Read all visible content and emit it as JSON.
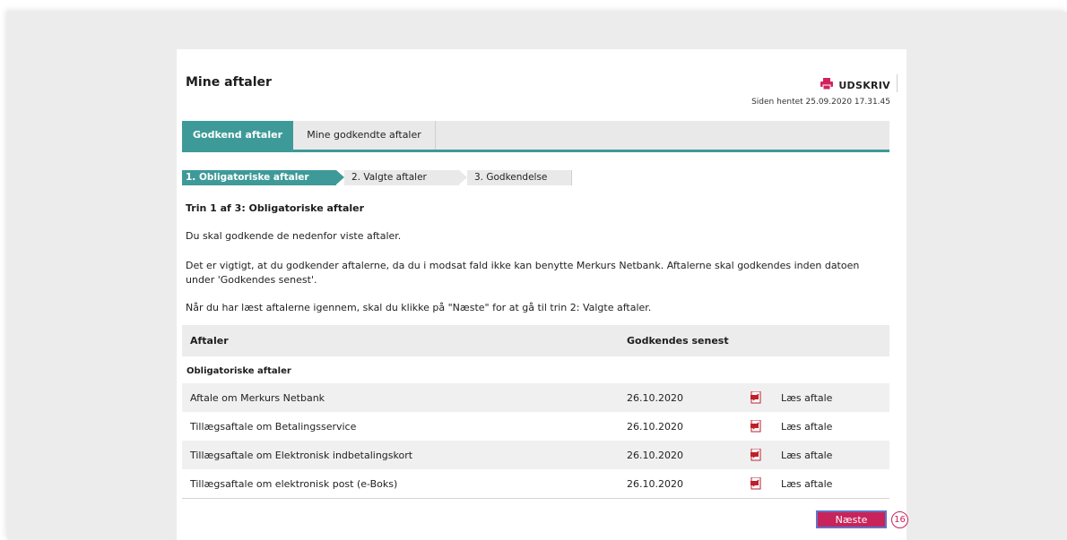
{
  "header": {
    "title": "Mine aftaler",
    "print_label": "UDSKRIV",
    "fetched_text": "Siden hentet 25.09.2020 17.31.45"
  },
  "tabs": [
    {
      "label": "Godkend aftaler",
      "active": true
    },
    {
      "label": "Mine godkendte aftaler",
      "active": false
    }
  ],
  "steps": [
    {
      "label": "1. Obligatoriske aftaler",
      "active": true
    },
    {
      "label": "2. Valgte aftaler",
      "active": false
    },
    {
      "label": "3. Godkendelse",
      "active": false
    }
  ],
  "content": {
    "step_title": "Trin 1 af 3: Obligatoriske aftaler",
    "paragraph1": "Du skal godkende de nedenfor viste aftaler.",
    "paragraph2": "Det er vigtigt, at du godkender aftalerne, da du i modsat fald ikke kan benytte Merkurs Netbank. Aftalerne skal godkendes inden datoen under 'Godkendes senest'.",
    "paragraph3": "Når du har læst aftalerne igennem, skal du klikke på \"Næste\" for at gå til trin 2: Valgte aftaler."
  },
  "table": {
    "headers": {
      "name": "Aftaler",
      "date": "Godkendes senest"
    },
    "group_title": "Obligatoriske aftaler",
    "rows": [
      {
        "name": "Aftale om Merkurs Netbank",
        "date": "26.10.2020",
        "icon": "pdf-icon",
        "link": "Læs aftale"
      },
      {
        "name": "Tillægsaftale om Betalingsservice",
        "date": "26.10.2020",
        "icon": "pdf-icon",
        "link": "Læs aftale"
      },
      {
        "name": "Tillægsaftale om Elektronisk indbetalingskort",
        "date": "26.10.2020",
        "icon": "pdf-icon",
        "link": "Læs aftale"
      },
      {
        "name": "Tillægsaftale om elektronisk post (e-Boks)",
        "date": "26.10.2020",
        "icon": "pdf-icon",
        "link": "Læs aftale"
      }
    ]
  },
  "actions": {
    "next_label": "Næste",
    "marker_number": "16"
  },
  "colors": {
    "accent": "#3e9a98",
    "button": "#c8235a",
    "print_icon": "#d1245f"
  }
}
